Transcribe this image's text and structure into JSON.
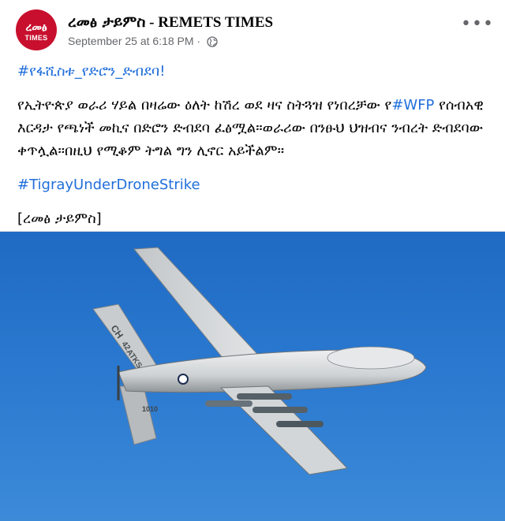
{
  "post": {
    "page_name_amharic": "ረመፅ ታይምስ",
    "page_name_separator": " - ",
    "page_name_latin": "REMETS TIMES",
    "avatar_text_line1": "ረመፅ",
    "avatar_text_line2": "TIMES",
    "timestamp": "September 25 at 6:18 PM",
    "meta_separator": " · ",
    "privacy_icon": "globe-icon",
    "more_label": "•••",
    "hashtag_top": "#የፋሺስቱ_የድሮን_ድብደባ!",
    "body_line_prefix": "የኢትዮጵያ ወራሪ ሃይል በዛሬው ዕለት ከሽረ ወደ ዛና ስትጓዝ የነበረቻው የ",
    "body_hashtag_wfp": "#WFP",
    "body_line_suffix": " የሰብአዊ እርዳታ የጫነች መኪና በድሮን ድብደባ ፈፅሟል፡፡ወራሪው በንፁህ ህዝብና ንብረት ድብደባው ቀጥሏል፡፡በዚህ የሚቆም ትግል ግን ሊኖር አይችልም፡፡",
    "hashtag_bottom": "#TigrayUnderDroneStrike",
    "signature": "[ረመፅ ታይምስ]"
  },
  "photo": {
    "tail_code": "CH",
    "tail_number": "42",
    "tail_text": "ATKS",
    "wing_code": "1010",
    "colors": {
      "sky": "#2a78cf",
      "drone_body": "#d9dbdc",
      "drone_shadow": "#8f9498"
    }
  },
  "colors": {
    "link": "#216fdb",
    "secondary_text": "#65676b",
    "avatar_bg": "#c8102e"
  }
}
